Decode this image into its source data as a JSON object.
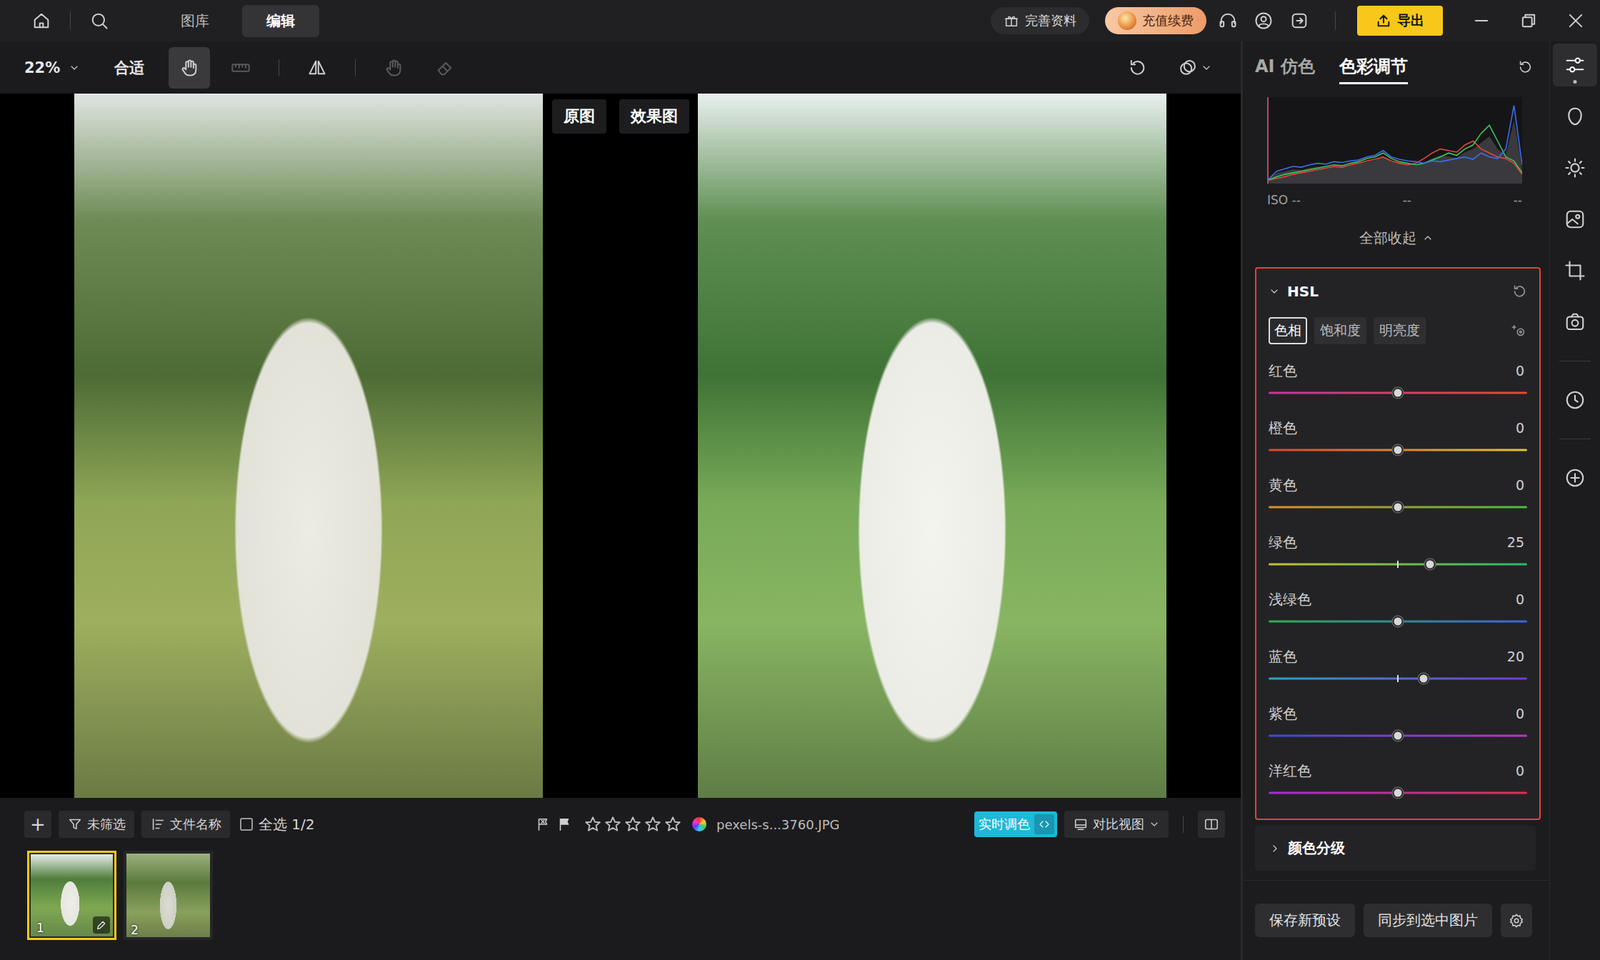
{
  "topbar": {
    "tabs": [
      {
        "label": "图库",
        "selected": false
      },
      {
        "label": "编辑",
        "selected": true
      }
    ],
    "profile_button": "完善资料",
    "recharge_button": "充值续费",
    "export_button": "导出"
  },
  "toolbar": {
    "zoom": "22%",
    "fit": "合适",
    "tools": [
      {
        "kind": "hand",
        "selected": true,
        "disabled": false
      },
      {
        "kind": "ruler",
        "selected": false,
        "disabled": true
      },
      {
        "kind": "mirror",
        "selected": false,
        "disabled": false
      },
      {
        "kind": "touch",
        "selected": false,
        "disabled": true
      },
      {
        "kind": "eraser",
        "selected": false,
        "disabled": true
      }
    ]
  },
  "compare": {
    "original_label": "原图",
    "effect_label": "效果图"
  },
  "filmstrip": {
    "add": "+",
    "filter": "未筛选",
    "sort": "文件名称",
    "select_all": {
      "label": "全选 1/2",
      "checked": false
    },
    "stars": 0,
    "filename": "pexels-s...3760.JPG",
    "live_toggle": {
      "label": "实时调色",
      "on": true
    },
    "view": "对比视图",
    "thumbnails": [
      {
        "number": "1",
        "selected": true,
        "edited": true
      },
      {
        "number": "2",
        "selected": false,
        "edited": false
      }
    ]
  },
  "panel": {
    "tabs": [
      {
        "label": "AI 仿色",
        "selected": false
      },
      {
        "label": "色彩调节",
        "selected": true
      }
    ],
    "histogram": {
      "series": [
        {
          "color": "#e8463c",
          "values": [
            1,
            3,
            5,
            8,
            10,
            12,
            14,
            16,
            18,
            17,
            20,
            22,
            25,
            27,
            30,
            25,
            22,
            20,
            22,
            28,
            35,
            40,
            38,
            36,
            45,
            50,
            40,
            35,
            30,
            28,
            22,
            8
          ]
        },
        {
          "color": "#3cc85a",
          "values": [
            1,
            5,
            8,
            10,
            12,
            14,
            16,
            18,
            20,
            19,
            22,
            24,
            28,
            30,
            35,
            28,
            24,
            22,
            20,
            22,
            26,
            30,
            35,
            32,
            40,
            45,
            60,
            70,
            50,
            30,
            25,
            10
          ]
        },
        {
          "color": "#3c6ef0",
          "values": [
            2,
            12,
            15,
            18,
            17,
            20,
            22,
            21,
            24,
            23,
            25,
            26,
            30,
            32,
            38,
            30,
            27,
            25,
            24,
            22,
            25,
            24,
            26,
            28,
            30,
            27,
            35,
            30,
            28,
            40,
            95,
            20
          ]
        }
      ]
    },
    "iso": [
      "ISO --",
      "--",
      "--"
    ],
    "collapse_all": "全部收起",
    "hsl": {
      "title": "HSL",
      "expanded": true,
      "modes": [
        {
          "label": "色相",
          "selected": true
        },
        {
          "label": "饱和度",
          "selected": false
        },
        {
          "label": "明亮度",
          "selected": false
        }
      ],
      "sliders": [
        {
          "label": "红色",
          "value": "0",
          "level": 0.5,
          "colors": [
            "#c8379e",
            "#e44a32"
          ]
        },
        {
          "label": "橙色",
          "value": "0",
          "level": 0.5,
          "colors": [
            "#e0442c",
            "#e2c82a"
          ]
        },
        {
          "label": "黄色",
          "value": "0",
          "level": 0.5,
          "colors": [
            "#e08c2a",
            "#4cbc3a"
          ]
        },
        {
          "label": "绿色",
          "value": "25",
          "level": 0.625,
          "colors": [
            "#c4c232",
            "#2fb66a"
          ]
        },
        {
          "label": "浅绿色",
          "value": "0",
          "level": 0.5,
          "colors": [
            "#2fae52",
            "#3a66d6"
          ]
        },
        {
          "label": "蓝色",
          "value": "20",
          "level": 0.6,
          "colors": [
            "#2aa6c6",
            "#7a38d0"
          ]
        },
        {
          "label": "紫色",
          "value": "0",
          "level": 0.5,
          "colors": [
            "#3a4ed0",
            "#c030c0"
          ]
        },
        {
          "label": "洋红色",
          "value": "0",
          "level": 0.5,
          "colors": [
            "#a030d0",
            "#e0304e"
          ]
        }
      ]
    },
    "color_grading": {
      "title": "颜色分级",
      "expanded": false
    },
    "buttons": [
      "保存新预设",
      "同步到选中图片"
    ]
  },
  "rail": [
    {
      "selected": true
    },
    {
      "selected": false
    },
    {
      "selected": false
    },
    {
      "selected": false
    },
    {
      "selected": false
    },
    {
      "selected": false
    },
    {
      "selected": false
    },
    {
      "selected": false
    }
  ]
}
